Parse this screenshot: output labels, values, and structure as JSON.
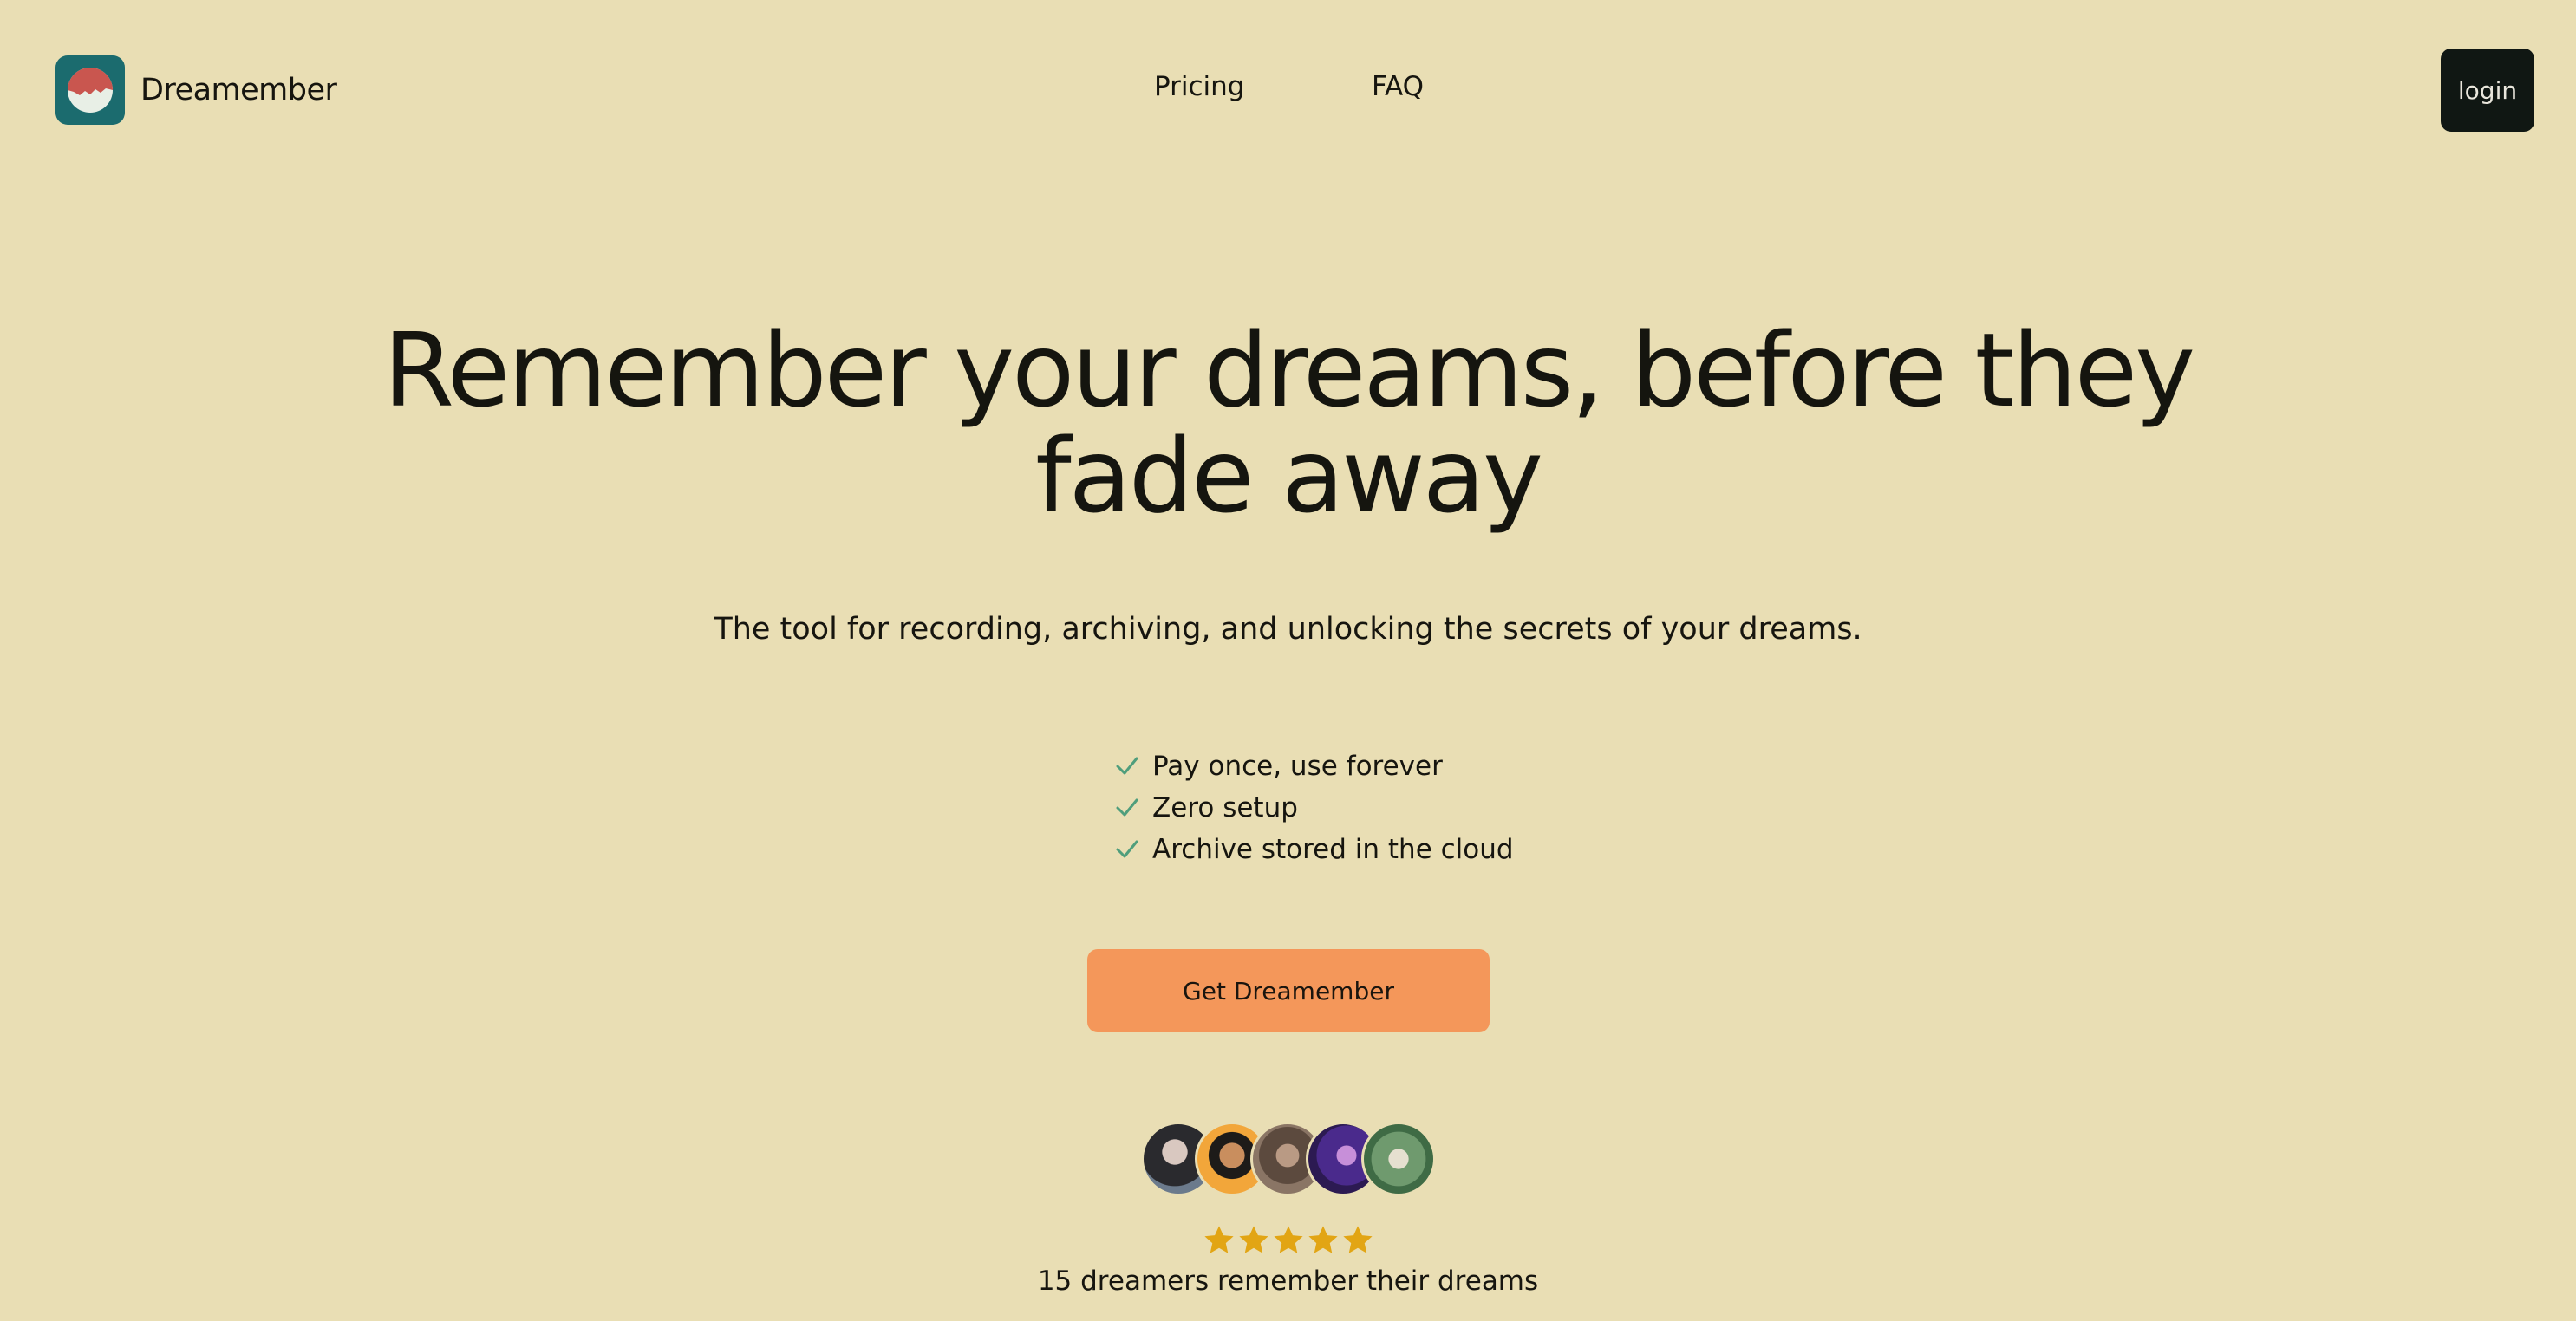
{
  "header": {
    "brand_name": "Dreamember",
    "nav": [
      {
        "label": "Pricing"
      },
      {
        "label": "FAQ"
      }
    ],
    "login_label": "login"
  },
  "hero": {
    "title_line1": "Remember your dreams, before they",
    "title_line2": "fade away",
    "subtitle": "The tool for recording, archiving, and unlocking the secrets of your dreams.",
    "features": [
      {
        "text": "Pay once, use forever"
      },
      {
        "text": "Zero setup"
      },
      {
        "text": "Archive stored in the cloud"
      }
    ],
    "cta_label": "Get Dreamember"
  },
  "social_proof": {
    "avatar_count": 5,
    "rating_stars": 5,
    "text": "15 dreamers remember their dreams"
  },
  "colors": {
    "background": "#e9deb4",
    "logo_bg": "#1b6b6e",
    "logo_red": "#c9564f",
    "cta": "#f4975a",
    "login_bg": "#101713",
    "check": "#4f9e7c",
    "star": "#e2a514"
  },
  "icons": [
    "dreamember-logo-icon",
    "check-icon",
    "star-icon"
  ]
}
